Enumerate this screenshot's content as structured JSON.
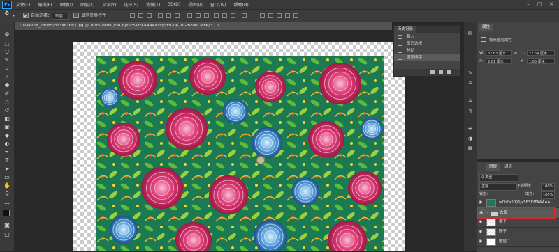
{
  "app": {
    "logo": "Ps"
  },
  "menu": [
    "文件(F)",
    "编辑(E)",
    "图像(I)",
    "图层(L)",
    "文字(Y)",
    "选择(S)",
    "滤镜(T)",
    "3D(D)",
    "视图(V)",
    "窗口(W)",
    "帮助(H)"
  ],
  "options_bar": {
    "auto_select_label": "自动选择：",
    "auto_select_checked": true,
    "auto_select_value": "图层",
    "transform_controls_label": "显示变换控件"
  },
  "document": {
    "tab_title": "1024x768_2d0ec2333ab16b3.jpg @ 100% (w0hQcVQ6jx5E5KfFAAAAANOrpzEfG06, RGB/8#/CMYK) *"
  },
  "history_panel": {
    "title": "历史记录",
    "items": [
      "载入",
      "取消选择",
      "移动",
      "图层顺序"
    ],
    "active_index": 3
  },
  "properties_panel": {
    "title": "属性",
    "heading": "像素图层属性",
    "w_label": "W:",
    "w_value": "32.63 厘米",
    "h_label": "H:",
    "h_value": "22.54 厘米",
    "x_label": "X:",
    "x_value": "2.61 厘米",
    "y_label": "Y:",
    "y_value": "1.05 厘米"
  },
  "layers_panel": {
    "tabs": [
      "图层",
      "通道"
    ],
    "active_tab": 0,
    "filter_label": "类型",
    "blend_mode": "正常",
    "opacity_label": "不透明度：",
    "opacity_value": "100%",
    "lock_label": "锁定：",
    "fill_label": "填充：",
    "fill_value": "100%",
    "layers": [
      {
        "name": "w0hQcVQ6jx5E5KfFAAAAA...",
        "type": "image"
      },
      {
        "name": "衣服",
        "type": "folder",
        "selected": true
      },
      {
        "name": "裤子",
        "type": "checker"
      },
      {
        "name": "鞋子",
        "type": "checker"
      },
      {
        "name": "图层 1",
        "type": "shape"
      }
    ]
  },
  "colors": {
    "highlight": "#e1262b",
    "accent": "#31a8ff"
  }
}
